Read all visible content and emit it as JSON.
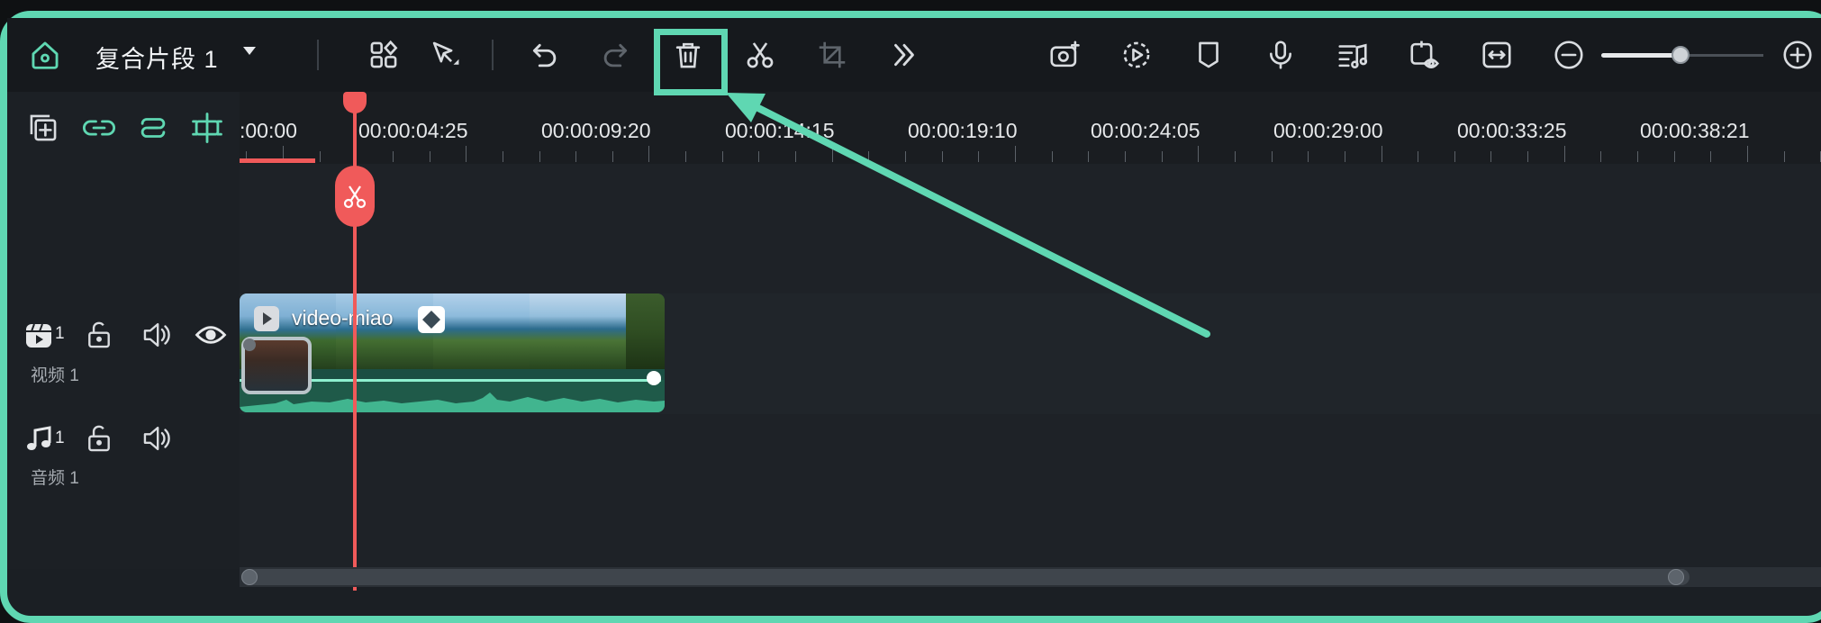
{
  "project": {
    "title": "复合片段 1"
  },
  "ruler": {
    "labels": [
      ":00:00",
      "00:00:04:25",
      "00:00:09:20",
      "00:00:14:15",
      "00:00:19:10",
      "00:00:24:05",
      "00:00:29:00",
      "00:00:33:25",
      "00:00:38:21"
    ]
  },
  "tracks": {
    "video": {
      "number": "1",
      "label": "视频 1"
    },
    "audio": {
      "number": "1",
      "label": "音频 1"
    }
  },
  "clip": {
    "name": "video-miao"
  },
  "zoom": {
    "level": 0.5
  },
  "colors": {
    "accent": "#5fd7b2",
    "playhead": "#f05a5a",
    "toolbar_bg": "#16191d",
    "timeline_bg": "#1e2227"
  },
  "icons": [
    "home-icon",
    "layout-grid-icon",
    "select-arrow-icon",
    "undo-icon",
    "redo-icon",
    "delete-trash-icon",
    "scissors-split-icon",
    "crop-icon",
    "more-chevrons-icon",
    "ai-camera-icon",
    "speed-icon",
    "marker-icon",
    "microphone-icon",
    "audio-mix-icon",
    "preview-eye-icon",
    "fit-width-icon",
    "zoom-out-icon",
    "zoom-in-icon"
  ]
}
